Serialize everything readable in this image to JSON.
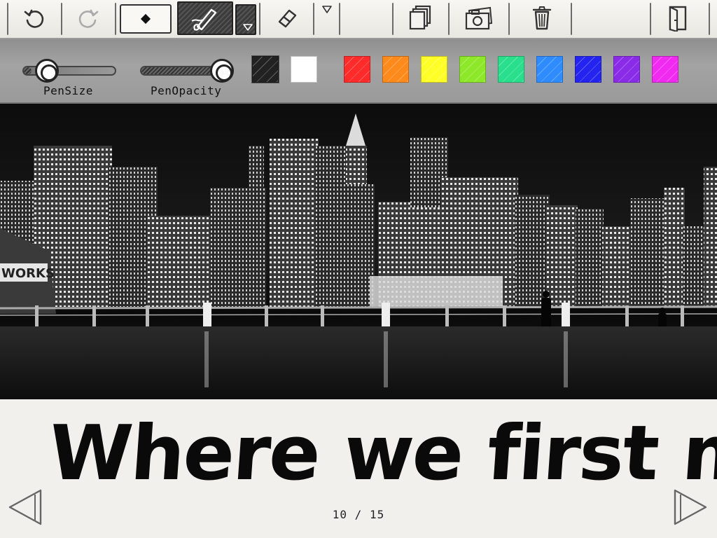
{
  "toolbar": {
    "buttons": [
      {
        "name": "undo",
        "icon": "undo-icon"
      },
      {
        "name": "redo",
        "icon": "redo-icon"
      },
      {
        "name": "pen-tip-size",
        "icon": "dot-icon"
      },
      {
        "name": "brush-tool",
        "icon": "brush-icon"
      },
      {
        "name": "brush-dropdown",
        "icon": "chevron-down-icon"
      },
      {
        "name": "eraser",
        "icon": "eraser-icon"
      },
      {
        "name": "eraser-dropdown",
        "icon": "chevron-down-icon"
      },
      {
        "name": "pages",
        "icon": "pages-icon"
      },
      {
        "name": "camera",
        "icon": "camera-icon"
      },
      {
        "name": "trash",
        "icon": "trash-icon"
      },
      {
        "name": "exit",
        "icon": "exit-door-icon"
      }
    ]
  },
  "pen": {
    "size_label": "PenSize",
    "opacity_label": "PenOpacity",
    "size_value": 0.1,
    "opacity_value": 0.9,
    "colors": [
      "#222222",
      "#ffffff",
      "#ff2a2a",
      "#ff8a1c",
      "#ffff28",
      "#8ee82a",
      "#2adf8c",
      "#2f8cff",
      "#2424f0",
      "#8a2be8",
      "#f02af0"
    ],
    "selected_color": "#222222"
  },
  "photo": {
    "sign_text": "WORKS",
    "description_icon": "city-skyline-photo"
  },
  "caption": {
    "text": "Where we first met"
  },
  "pager": {
    "current": 10,
    "total": 15,
    "label": "10 / 15"
  }
}
